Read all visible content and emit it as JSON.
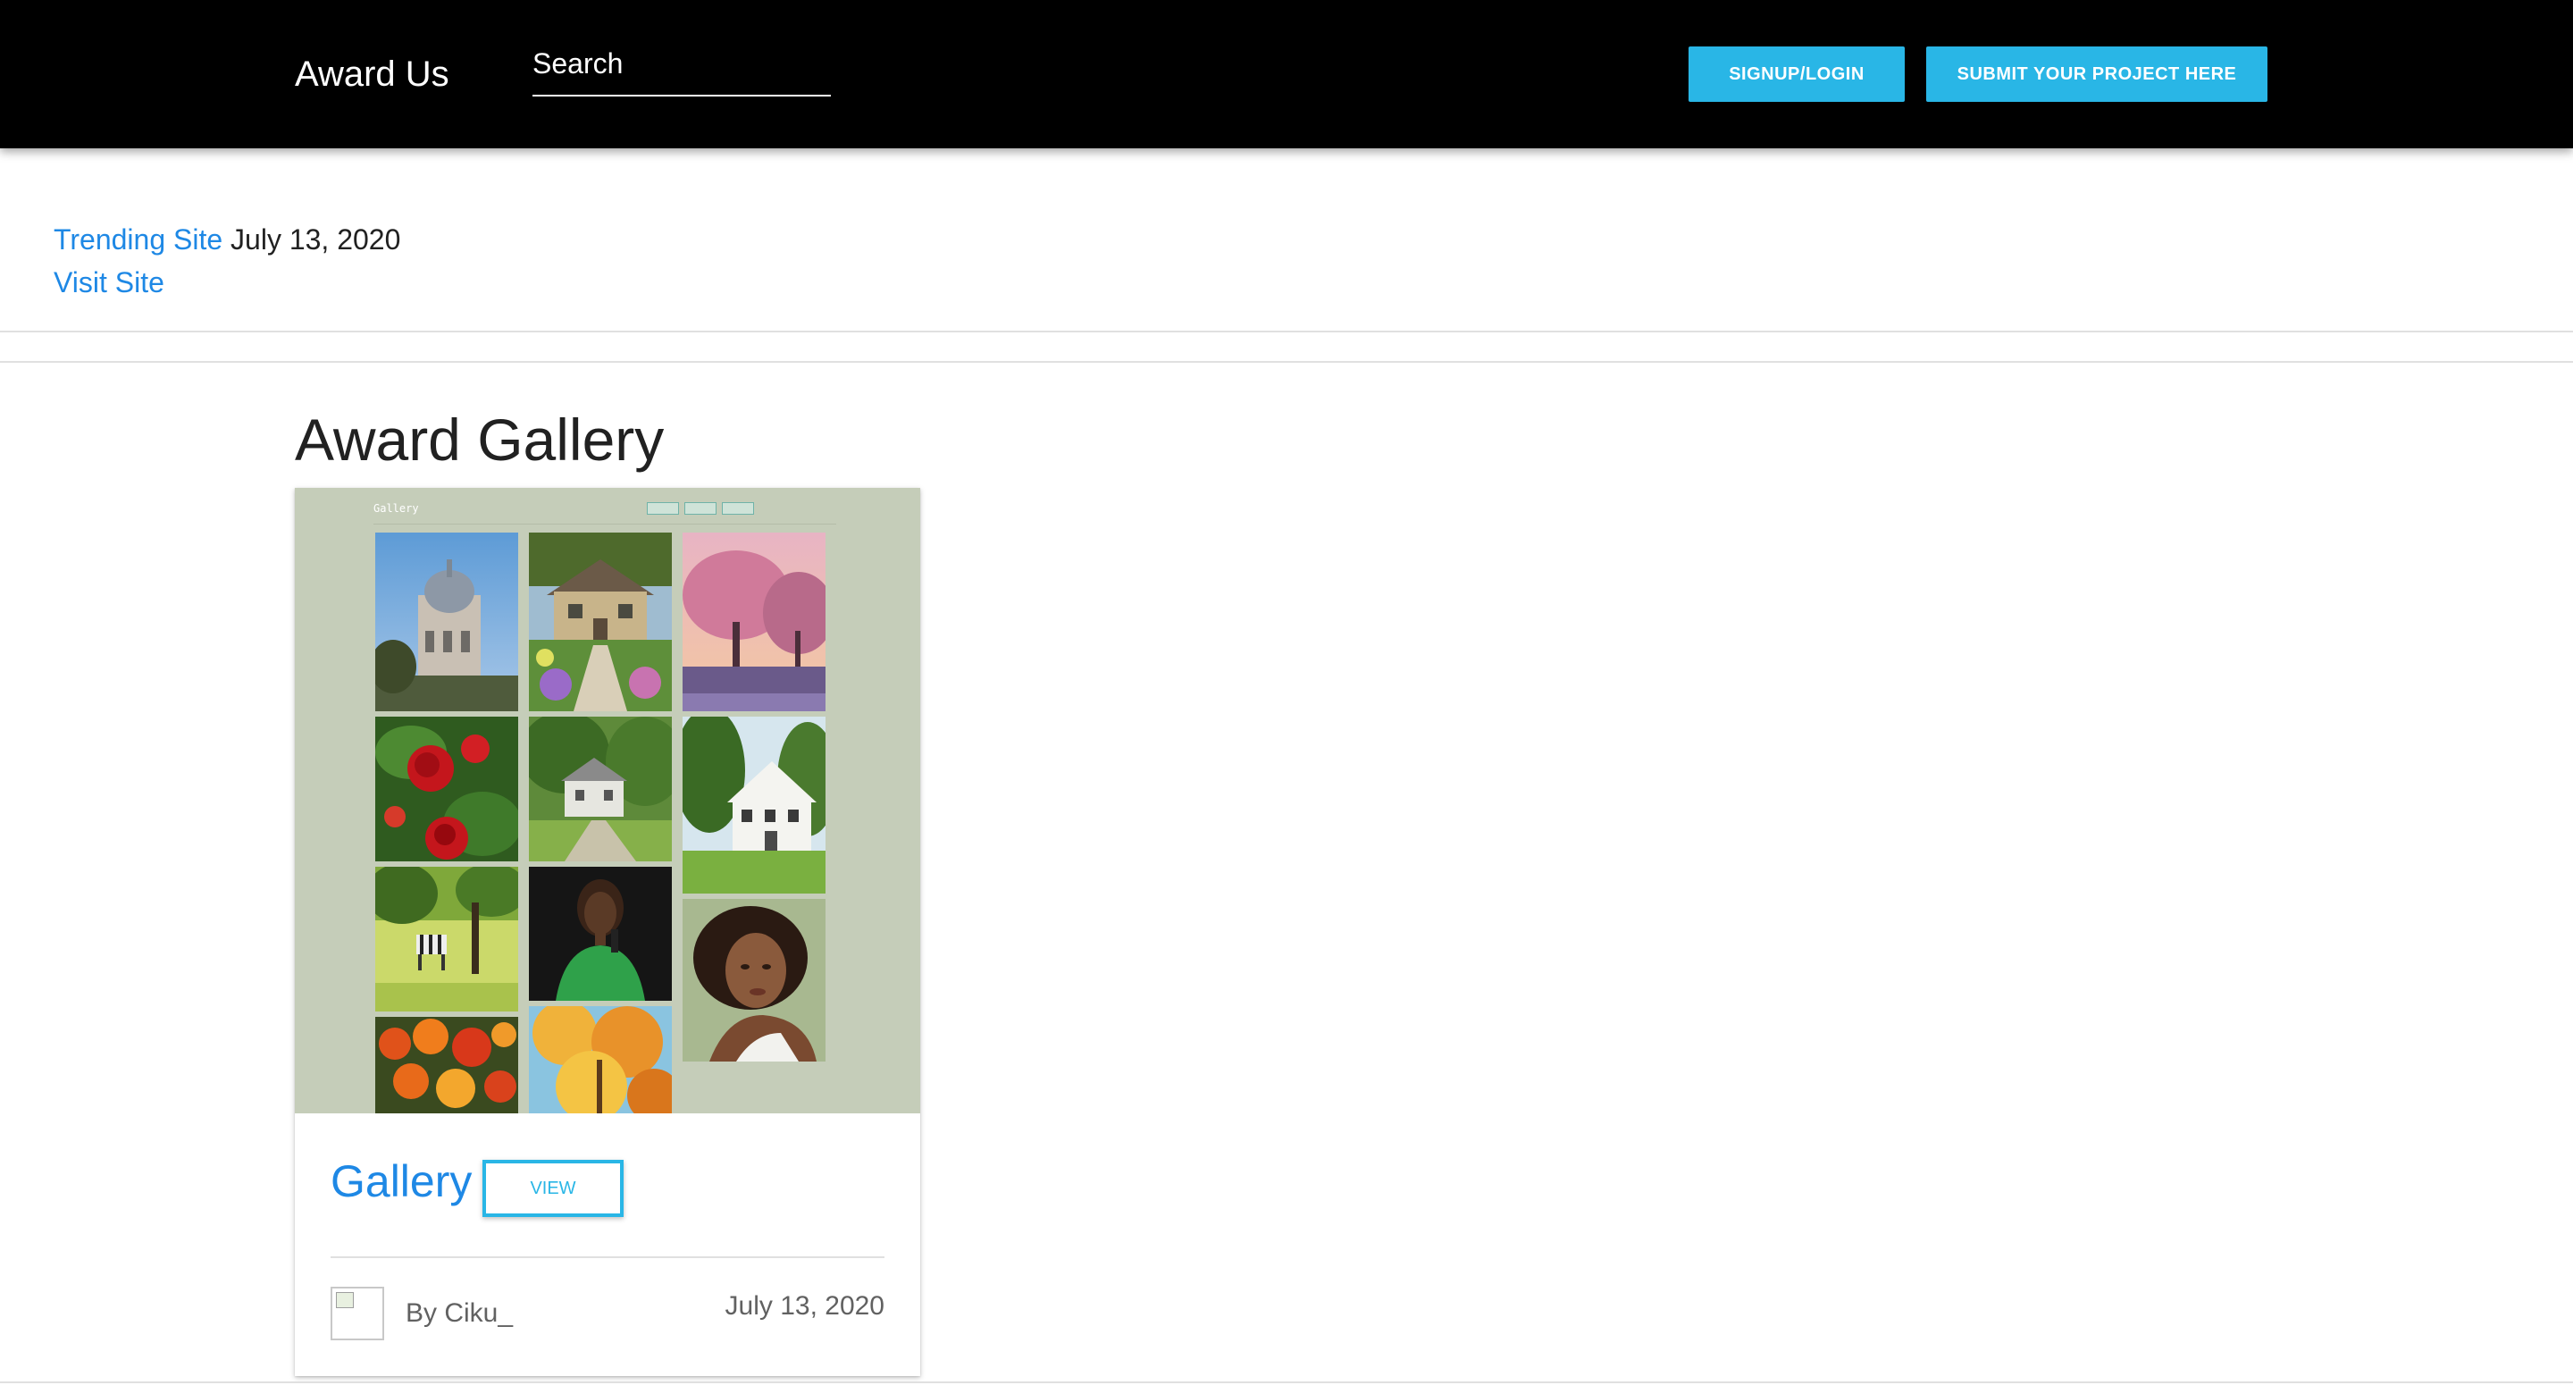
{
  "navbar": {
    "brand": "Award Us",
    "search_placeholder": "Search",
    "signup_label": "SIGNUP/LOGIN",
    "submit_label": "SUBMIT YOUR PROJECT HERE",
    "accent_color": "#29b6e6"
  },
  "trending": {
    "label": "Trending Site",
    "date": "July 13, 2020",
    "visit_label": "Visit Site",
    "link_color": "#1e88e5"
  },
  "gallery": {
    "heading": "Award Gallery",
    "cards": [
      {
        "title": "Gallery",
        "view_label": "VIEW",
        "author": "By Ciku_",
        "date": "July 13, 2020",
        "preview": {
          "site_title": "Gallery",
          "thumbnails": [
            "cathedral",
            "cottage-garden",
            "pink-blossom-tree",
            "red-roses",
            "white-house-trees",
            "white-farmhouse",
            "zebra-meadow",
            "woman-green-dress",
            "portrait-curly-hair",
            "orange-flowers",
            "autumn-leaves"
          ]
        }
      }
    ]
  }
}
